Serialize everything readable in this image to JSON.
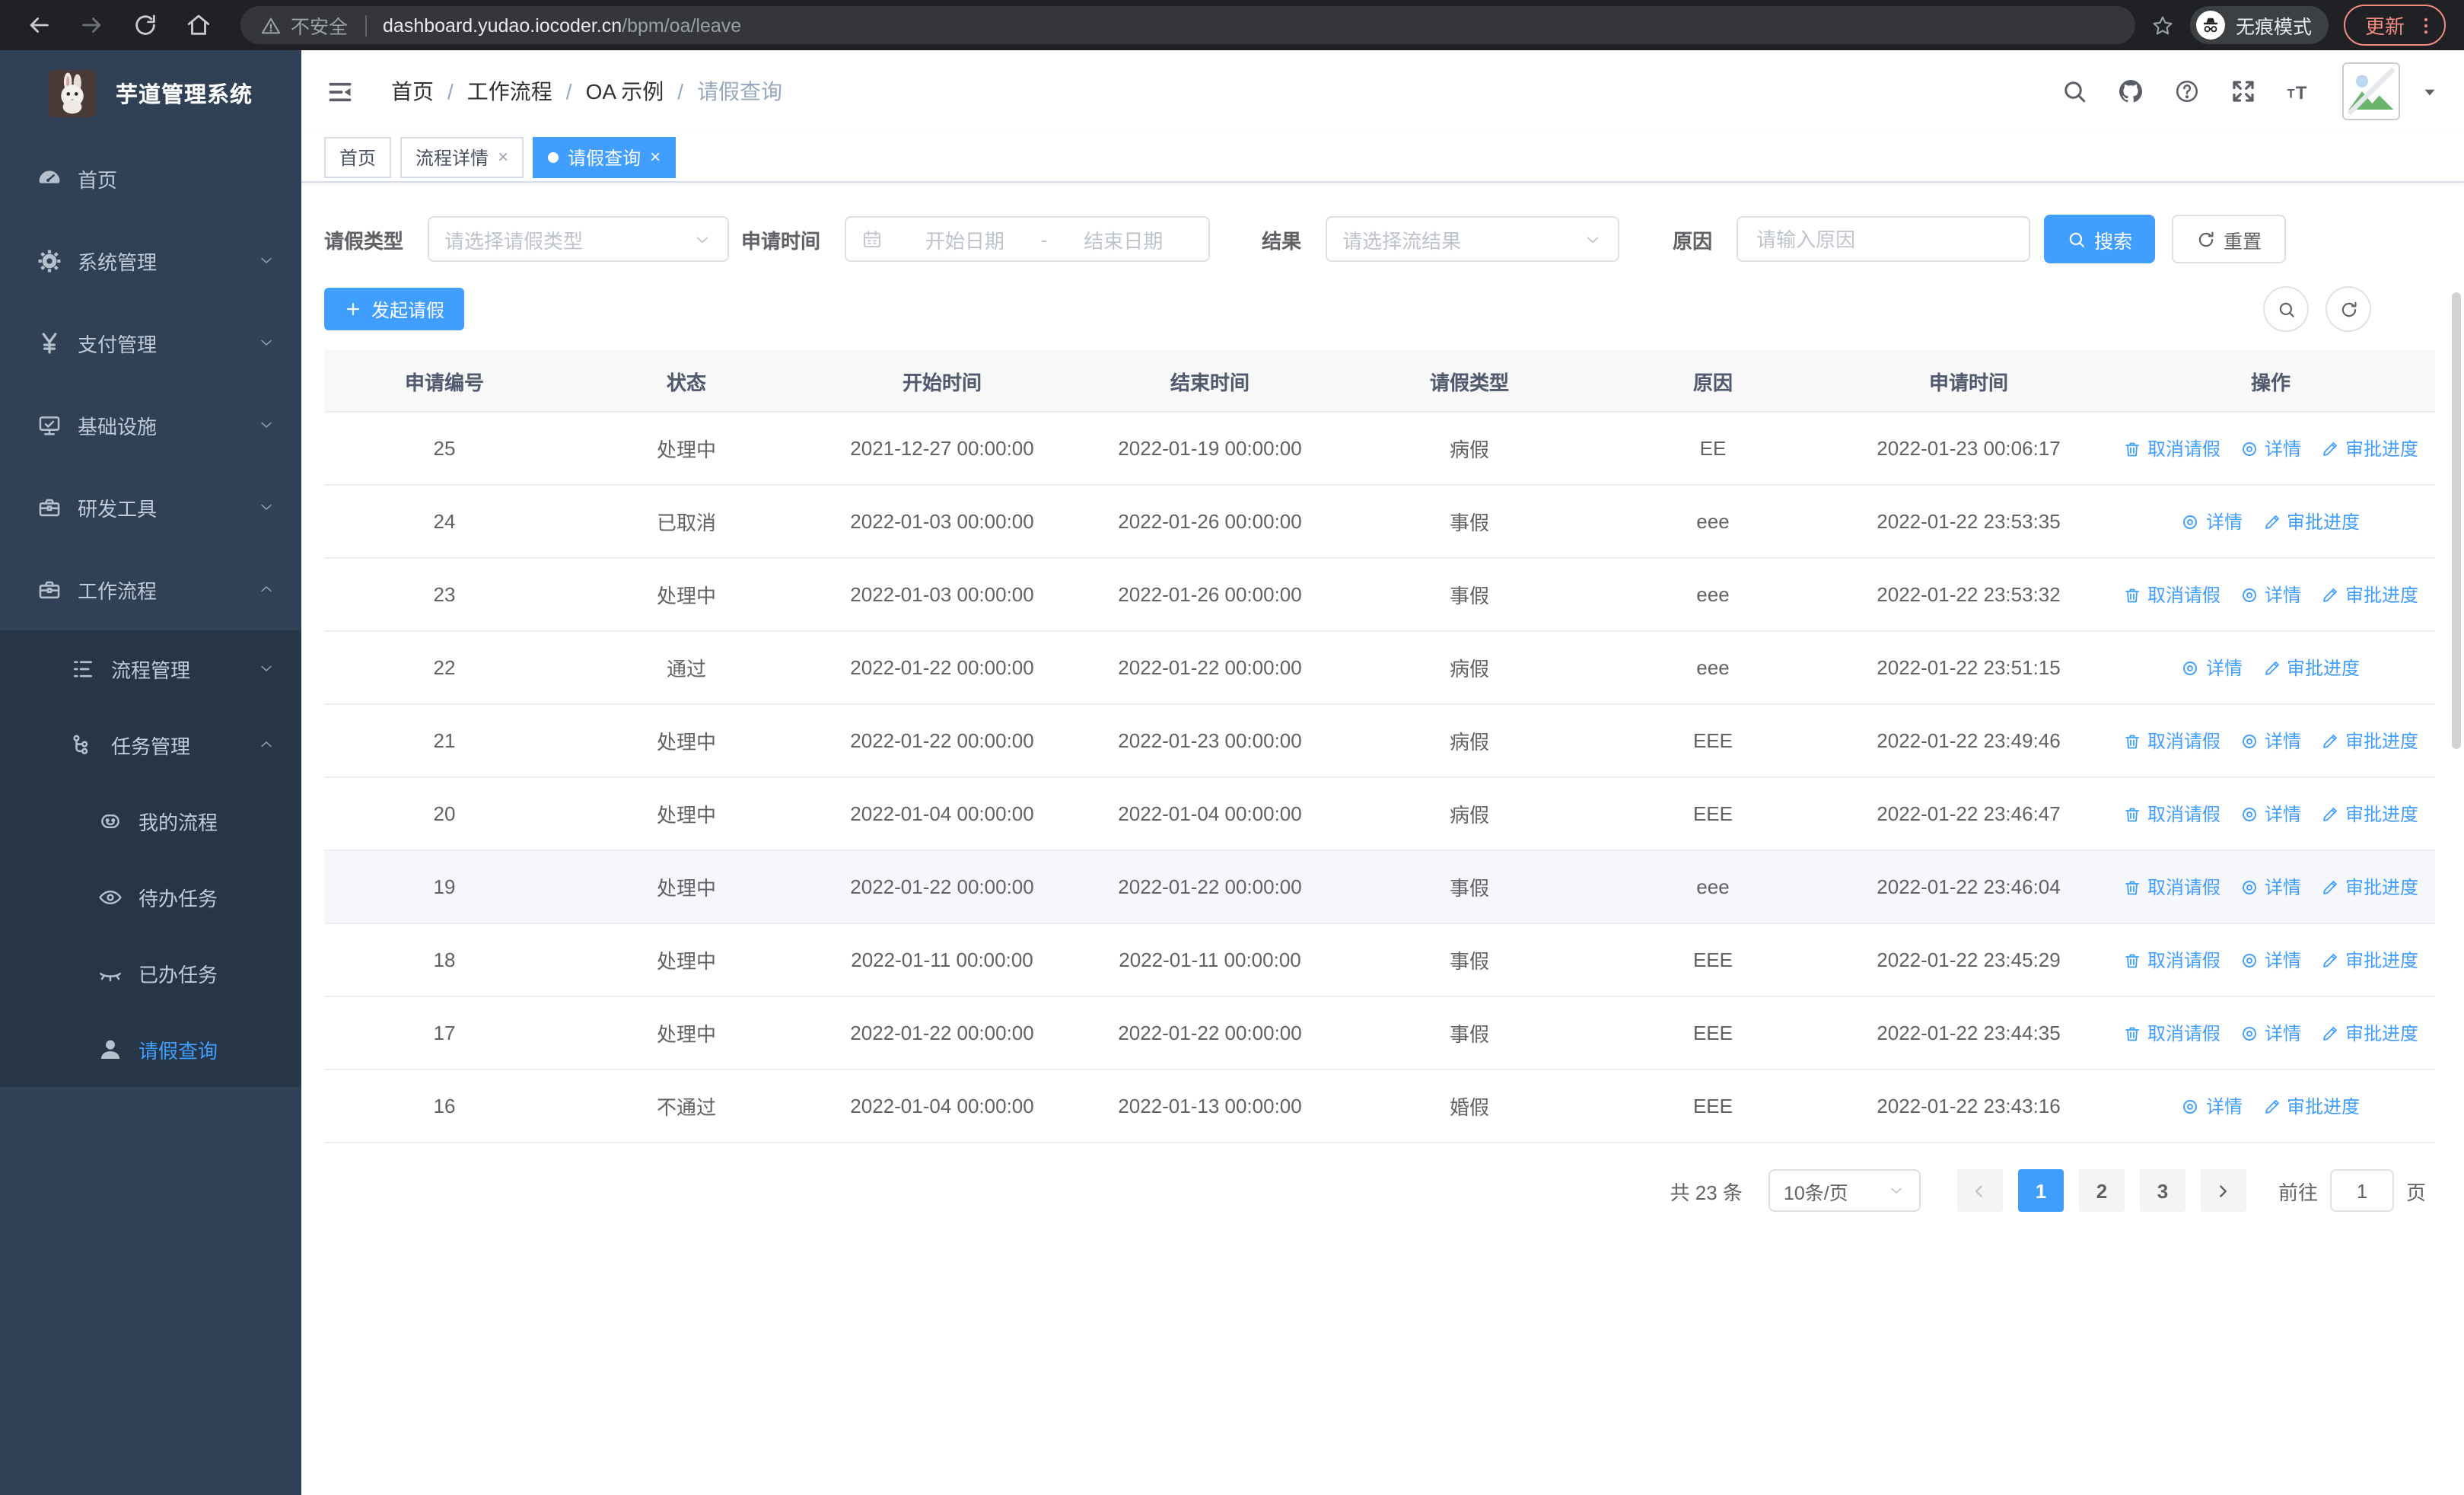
{
  "colors": {
    "primary": "#409eff",
    "sidebar_bg": "#304156",
    "submenu_bg": "#263647",
    "update_accent": "#f28b82",
    "tab_active": "#409eff"
  },
  "browser": {
    "security_label": "不安全",
    "url_host": "dashboard.yudao.iocoder.cn",
    "url_path": "/bpm/oa/leave",
    "incognito_label": "无痕模式",
    "update_label": "更新"
  },
  "sidebar": {
    "title": "芋道管理系统",
    "items": [
      {
        "label": "首页",
        "icon": "dashboard-icon",
        "level": 1
      },
      {
        "label": "系统管理",
        "icon": "gear-icon",
        "level": 1,
        "chevron": "down"
      },
      {
        "label": "支付管理",
        "icon": "yen-icon",
        "level": 1,
        "chevron": "down"
      },
      {
        "label": "基础设施",
        "icon": "monitor-icon",
        "level": 1,
        "chevron": "down"
      },
      {
        "label": "研发工具",
        "icon": "toolbox-icon",
        "level": 1,
        "chevron": "down"
      },
      {
        "label": "工作流程",
        "icon": "briefcase-icon",
        "level": 1,
        "chevron": "up"
      },
      {
        "label": "流程管理",
        "icon": "list-icon",
        "level": 2,
        "chevron": "down",
        "submenu": true
      },
      {
        "label": "任务管理",
        "icon": "tree-icon",
        "level": 2,
        "chevron": "up",
        "submenu": true
      },
      {
        "label": "我的流程",
        "icon": "robot-icon",
        "level": 3,
        "submenu": true
      },
      {
        "label": "待办任务",
        "icon": "eye-icon",
        "level": 3,
        "submenu": true
      },
      {
        "label": "已办任务",
        "icon": "eye-closed-icon",
        "level": 3,
        "submenu": true
      },
      {
        "label": "请假查询",
        "icon": "user-icon",
        "level": 3,
        "submenu": true,
        "active": true
      }
    ]
  },
  "header": {
    "breadcrumb": [
      "首页",
      "工作流程",
      "OA 示例",
      "请假查询"
    ],
    "breadcrumb_separator": "/"
  },
  "tabs": {
    "close_glyph": "×",
    "items": [
      {
        "label": "首页",
        "closable": false,
        "active": false
      },
      {
        "label": "流程详情",
        "closable": true,
        "active": false
      },
      {
        "label": "请假查询",
        "closable": true,
        "active": true
      }
    ]
  },
  "filters": {
    "leave_type_label": "请假类型",
    "leave_type_placeholder": "请选择请假类型",
    "apply_time_label": "申请时间",
    "start_date_placeholder": "开始日期",
    "range_separator": "-",
    "end_date_placeholder": "结束日期",
    "result_label": "结果",
    "result_placeholder": "请选择流结果",
    "reason_label": "原因",
    "reason_placeholder": "请输入原因",
    "search_label": "搜索",
    "reset_label": "重置"
  },
  "toolbar": {
    "create_label": "发起请假"
  },
  "table": {
    "columns": [
      "申请编号",
      "状态",
      "开始时间",
      "结束时间",
      "请假类型",
      "原因",
      "申请时间",
      "操作"
    ],
    "action_labels": {
      "cancel": "取消请假",
      "detail": "详情",
      "progress": "审批进度"
    },
    "rows": [
      {
        "id": "25",
        "status": "处理中",
        "start": "2021-12-27 00:00:00",
        "end": "2022-01-19 00:00:00",
        "type": "病假",
        "reason": "EE",
        "applied": "2022-01-23 00:06:17",
        "actions": [
          "cancel",
          "detail",
          "progress"
        ],
        "highlight": false
      },
      {
        "id": "24",
        "status": "已取消",
        "start": "2022-01-03 00:00:00",
        "end": "2022-01-26 00:00:00",
        "type": "事假",
        "reason": "eee",
        "applied": "2022-01-22 23:53:35",
        "actions": [
          "detail",
          "progress"
        ],
        "highlight": false
      },
      {
        "id": "23",
        "status": "处理中",
        "start": "2022-01-03 00:00:00",
        "end": "2022-01-26 00:00:00",
        "type": "事假",
        "reason": "eee",
        "applied": "2022-01-22 23:53:32",
        "actions": [
          "cancel",
          "detail",
          "progress"
        ],
        "highlight": false
      },
      {
        "id": "22",
        "status": "通过",
        "start": "2022-01-22 00:00:00",
        "end": "2022-01-22 00:00:00",
        "type": "病假",
        "reason": "eee",
        "applied": "2022-01-22 23:51:15",
        "actions": [
          "detail",
          "progress"
        ],
        "highlight": false
      },
      {
        "id": "21",
        "status": "处理中",
        "start": "2022-01-22 00:00:00",
        "end": "2022-01-23 00:00:00",
        "type": "病假",
        "reason": "EEE",
        "applied": "2022-01-22 23:49:46",
        "actions": [
          "cancel",
          "detail",
          "progress"
        ],
        "highlight": false
      },
      {
        "id": "20",
        "status": "处理中",
        "start": "2022-01-04 00:00:00",
        "end": "2022-01-04 00:00:00",
        "type": "病假",
        "reason": "EEE",
        "applied": "2022-01-22 23:46:47",
        "actions": [
          "cancel",
          "detail",
          "progress"
        ],
        "highlight": false
      },
      {
        "id": "19",
        "status": "处理中",
        "start": "2022-01-22 00:00:00",
        "end": "2022-01-22 00:00:00",
        "type": "事假",
        "reason": "eee",
        "applied": "2022-01-22 23:46:04",
        "actions": [
          "cancel",
          "detail",
          "progress"
        ],
        "highlight": true
      },
      {
        "id": "18",
        "status": "处理中",
        "start": "2022-01-11 00:00:00",
        "end": "2022-01-11 00:00:00",
        "type": "事假",
        "reason": "EEE",
        "applied": "2022-01-22 23:45:29",
        "actions": [
          "cancel",
          "detail",
          "progress"
        ],
        "highlight": false
      },
      {
        "id": "17",
        "status": "处理中",
        "start": "2022-01-22 00:00:00",
        "end": "2022-01-22 00:00:00",
        "type": "事假",
        "reason": "EEE",
        "applied": "2022-01-22 23:44:35",
        "actions": [
          "cancel",
          "detail",
          "progress"
        ],
        "highlight": false
      },
      {
        "id": "16",
        "status": "不通过",
        "start": "2022-01-04 00:00:00",
        "end": "2022-01-13 00:00:00",
        "type": "婚假",
        "reason": "EEE",
        "applied": "2022-01-22 23:43:16",
        "actions": [
          "detail",
          "progress"
        ],
        "highlight": false
      }
    ]
  },
  "pagination": {
    "total_label": "共 23 条",
    "page_size": "10条/页",
    "pages": [
      "1",
      "2",
      "3"
    ],
    "active_page": "1",
    "goto_label": "前往",
    "goto_value": "1",
    "page_unit": "页"
  }
}
